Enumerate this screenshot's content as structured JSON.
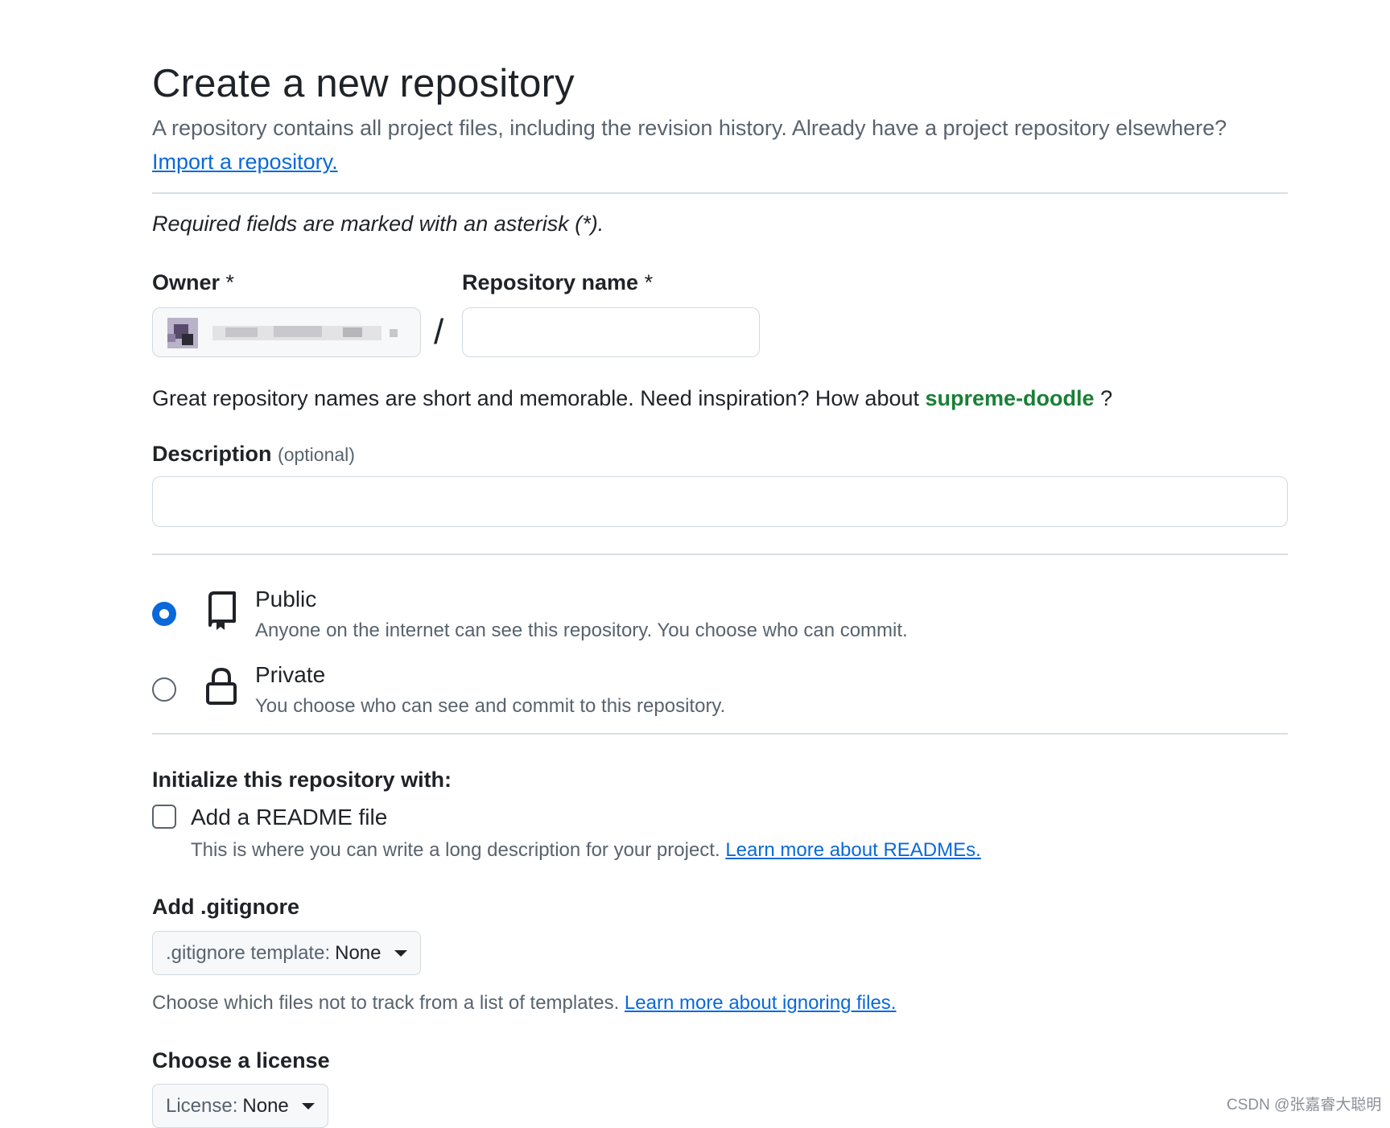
{
  "header": {
    "title": "Create a new repository",
    "subtitle": "A repository contains all project files, including the revision history. Already have a project repository elsewhere?",
    "import_link": "Import a repository."
  },
  "form": {
    "required_note": "Required fields are marked with an asterisk (*).",
    "owner": {
      "label": "Owner",
      "required_mark": "*"
    },
    "separator": "/",
    "repo_name": {
      "label": "Repository name",
      "required_mark": "*",
      "value": ""
    },
    "hint": {
      "text": "Great repository names are short and memorable. Need inspiration? How about",
      "suggestion": "supreme-doodle",
      "suffix": "?"
    },
    "description": {
      "label": "Description",
      "optional": "(optional)",
      "value": ""
    }
  },
  "visibility": {
    "selected": "public",
    "options": [
      {
        "title": "Public",
        "desc": "Anyone on the internet can see this repository. You choose who can commit.",
        "icon": "repo-icon"
      },
      {
        "title": "Private",
        "desc": "You choose who can see and commit to this repository.",
        "icon": "lock-icon"
      }
    ]
  },
  "init": {
    "heading": "Initialize this repository with:",
    "readme": {
      "label": "Add a README file",
      "checked": false,
      "desc": "This is where you can write a long description for your project.",
      "link": "Learn more about READMEs."
    },
    "gitignore": {
      "heading": "Add .gitignore",
      "button_prefix": ".gitignore template:",
      "button_value": "None",
      "note": "Choose which files not to track from a list of templates.",
      "link": "Learn more about ignoring files."
    },
    "license": {
      "heading": "Choose a license",
      "button_prefix": "License:",
      "button_value": "None"
    }
  },
  "watermark": "CSDN @张嘉睿大聪明",
  "colors": {
    "accent": "#0969da",
    "suggestion": "#1a7f37",
    "muted": "#59636e",
    "border": "#d1d9e0"
  }
}
